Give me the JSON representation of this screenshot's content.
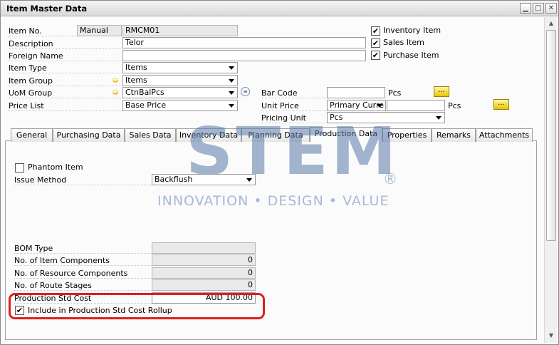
{
  "window": {
    "title": "Item Master Data"
  },
  "header": {
    "item_no_label": "Item No.",
    "item_no_series": "Manual",
    "item_no_value": "RMCM01",
    "description_label": "Description",
    "description_value": "Telor",
    "foreign_name_label": "Foreign Name",
    "foreign_name_value": "",
    "item_type_label": "Item Type",
    "item_type_value": "Items",
    "item_group_label": "Item Group",
    "item_group_value": "Items",
    "uom_group_label": "UoM Group",
    "uom_group_value": "CtnBalPcs",
    "price_list_label": "Price List",
    "price_list_value": "Base Price",
    "inventory_item_label": "Inventory Item",
    "inventory_item_checked": true,
    "sales_item_label": "Sales Item",
    "sales_item_checked": true,
    "purchase_item_label": "Purchase Item",
    "purchase_item_checked": true,
    "bar_code_label": "Bar Code",
    "bar_code_value": "",
    "bar_code_uom": "Pcs",
    "unit_price_label": "Unit Price",
    "unit_price_currency": "Primary Curre",
    "unit_price_value": "",
    "unit_price_uom": "Pcs",
    "pricing_unit_label": "Pricing Unit",
    "pricing_unit_value": "Pcs",
    "dots_label": "..."
  },
  "tabs": [
    {
      "label": "General"
    },
    {
      "label": "Purchasing Data"
    },
    {
      "label": "Sales Data"
    },
    {
      "label": "Inventory Data"
    },
    {
      "label": "Planning Data"
    },
    {
      "label": "Production Data",
      "active": true
    },
    {
      "label": "Properties"
    },
    {
      "label": "Remarks"
    },
    {
      "label": "Attachments"
    }
  ],
  "production": {
    "phantom_item_label": "Phantom Item",
    "phantom_item_checked": false,
    "issue_method_label": "Issue Method",
    "issue_method_value": "Backflush",
    "bom_type_label": "BOM Type",
    "bom_type_value": "",
    "item_components_label": "No. of Item Components",
    "item_components_value": "0",
    "resource_components_label": "No. of Resource Components",
    "resource_components_value": "0",
    "route_stages_label": "No. of Route Stages",
    "route_stages_value": "0",
    "std_cost_label": "Production Std Cost",
    "std_cost_value": "AUD 100.00",
    "rollup_label": "Include in Production Std Cost Rollup",
    "rollup_checked": true
  },
  "watermark": {
    "logo": "STEM",
    "reg": "®",
    "tagline": "INNOVATION • DESIGN • VALUE"
  },
  "colors": {
    "highlight": "#e11d1d",
    "arrow_icon": "#e8b000",
    "watermark": "#5a78aa"
  }
}
